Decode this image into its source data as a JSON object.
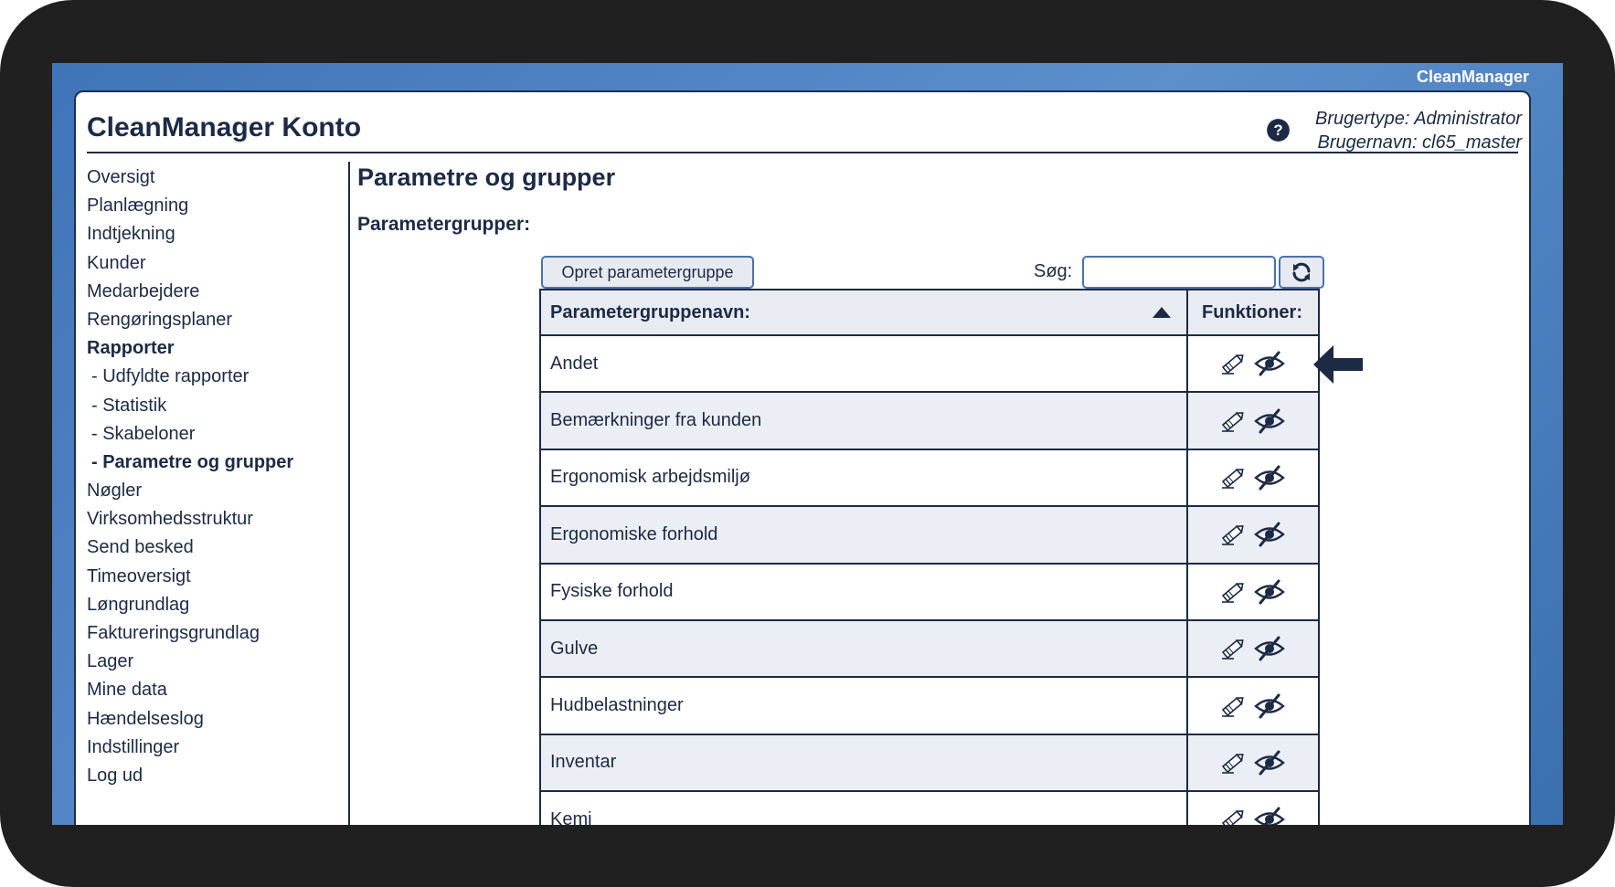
{
  "brand": "CleanManager",
  "header": {
    "title": "CleanManager Konto",
    "user_type": "Brugertype: Administrator",
    "user_name": "Brugernavn: cl65_master"
  },
  "sidebar": {
    "items": [
      {
        "label": "Oversigt",
        "style": "normal"
      },
      {
        "label": "Planlægning",
        "style": "normal"
      },
      {
        "label": "Indtjekning",
        "style": "normal"
      },
      {
        "label": "Kunder",
        "style": "normal"
      },
      {
        "label": "Medarbejdere",
        "style": "normal"
      },
      {
        "label": "Rengøringsplaner",
        "style": "normal"
      },
      {
        "label": "Rapporter",
        "style": "active"
      },
      {
        "label": "- Udfyldte rapporter",
        "style": "sub"
      },
      {
        "label": "- Statistik",
        "style": "sub"
      },
      {
        "label": "- Skabeloner",
        "style": "sub"
      },
      {
        "label": "- Parametre og grupper",
        "style": "sub-active"
      },
      {
        "label": "Nøgler",
        "style": "normal"
      },
      {
        "label": "Virksomhedsstruktur",
        "style": "normal"
      },
      {
        "label": "Send besked",
        "style": "normal"
      },
      {
        "label": "Timeoversigt",
        "style": "normal"
      },
      {
        "label": "Løngrundlag",
        "style": "normal"
      },
      {
        "label": "Faktureringsgrundlag",
        "style": "normal"
      },
      {
        "label": "Lager",
        "style": "normal"
      },
      {
        "label": "Mine data",
        "style": "normal"
      },
      {
        "label": "Hændelseslog",
        "style": "normal"
      },
      {
        "label": "Indstillinger",
        "style": "normal"
      },
      {
        "label": "Log ud",
        "style": "normal"
      }
    ]
  },
  "main": {
    "page_title": "Parametre og grupper",
    "section_title": "Parametergrupper:",
    "create_button": "Opret parametergruppe",
    "search_label": "Søg:",
    "search_value": "",
    "table": {
      "col_name": "Parametergruppenavn:",
      "col_functions": "Funktioner:",
      "sort": "ascending",
      "rows": [
        "Andet",
        "Bemærkninger fra kunden",
        "Ergonomisk arbejdsmiljø",
        "Ergonomiske forhold",
        "Fysiske forhold",
        "Gulve",
        "Hudbelastninger",
        "Inventar",
        "Kemi"
      ]
    }
  },
  "icons": {
    "help": "help-circle-icon",
    "refresh": "refresh-icon",
    "edit": "pencil-icon",
    "hide": "eye-slash-icon",
    "sort": "sort-up-icon",
    "callout": "arrow-left-icon"
  },
  "colors": {
    "background_blue": "#4a7fc1",
    "text_dark": "#1c2a45",
    "row_alt": "#eceef5",
    "bezel": "#202020"
  }
}
